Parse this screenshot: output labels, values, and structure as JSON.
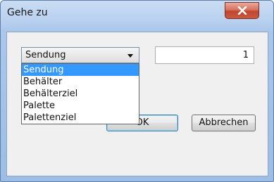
{
  "window": {
    "title": "Gehe zu",
    "close_icon": "close-x-icon"
  },
  "combo": {
    "selected": "Sendung",
    "options": [
      "Sendung",
      "Behälter",
      "Behälterziel",
      "Palette",
      "Palettenziel"
    ]
  },
  "number_field": {
    "value": "1"
  },
  "buttons": {
    "ok": "OK",
    "cancel": "Abbrechen"
  },
  "colors": {
    "selection": "#3399ff",
    "close_button": "#c2442d"
  }
}
